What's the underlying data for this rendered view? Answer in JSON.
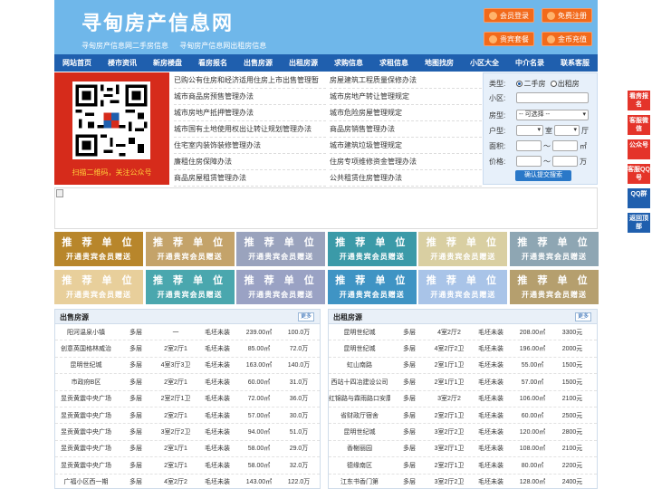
{
  "header": {
    "site_title": "寻甸房产信息网",
    "subtitle_1": "寻甸房产信息网二手房信息",
    "subtitle_2": "寻甸房产信息网出租房信息",
    "buttons": [
      "会员登录",
      "免费注册",
      "贵宾套餐",
      "金币充值"
    ],
    "bg_color": "#6fb7ea",
    "button_color": "#f26a1b"
  },
  "nav": {
    "items": [
      "网站首页",
      "楼市资讯",
      "新房楼盘",
      "看房报名",
      "出售房源",
      "出租房源",
      "求购信息",
      "求租信息",
      "地图找房",
      "小区大全",
      "中介名录",
      "联系客服"
    ],
    "bg_color": "#1f5fae"
  },
  "qr": {
    "caption": "扫描二维码，关注公众号"
  },
  "links": {
    "left": [
      "已购公有住房和经济适用住房上市出售管理暂",
      "城市商品房预售管理办法",
      "城市房地产抵押管理办法",
      "城市国有土地使用权出让转让规划管理办法",
      "住宅室内装饰装修管理办法",
      "廉租住房保障办法",
      "商品房屋租赁管理办法"
    ],
    "right": [
      "房屋建筑工程质量保修办法",
      "城市房地产转让管理规定",
      "城市危险房屋管理规定",
      "商品房销售管理办法",
      "城市建筑垃圾管理规定",
      "住房专项维修资金管理办法",
      "公共租赁住房管理办法"
    ]
  },
  "search": {
    "type_label": "类型:",
    "type_options": [
      "二手房",
      "出租房"
    ],
    "community_label": "小区:",
    "housetype_label": "房型:",
    "housetype_value": "-- 可选择 --",
    "layout_label": "户型:",
    "room_unit": "室",
    "hall_unit": "厅",
    "area_label": "面积:",
    "area_unit": "㎡",
    "range_sep": "〜",
    "price_label": "价格:",
    "price_unit": "万",
    "submit_label": "确认提交搜索"
  },
  "recommend": {
    "title": "推 荐 单 位",
    "subtitle": "开通贵宾会员赠送",
    "colors": [
      "#b8862b",
      "#c4a36a",
      "#9aa3bd",
      "#3b9aa8",
      "#d9cfa2",
      "#8ea6b3",
      "#e8cf9b",
      "#4aa7ae",
      "#9aa2c4",
      "#3f94c4",
      "#a9c4e8",
      "#b59f6e"
    ]
  },
  "sale": {
    "title": "出售房源",
    "more": "更多",
    "rows": [
      [
        "阳河温泉小镇",
        "多层",
        "一",
        "毛坯未装",
        "239.00㎡",
        "100.0万"
      ],
      [
        "创意英国格林威治",
        "多层",
        "2室2厅1",
        "毛坯未装",
        "85.00㎡",
        "72.0万"
      ],
      [
        "昆明世纪城",
        "多层",
        "4室3厅3卫",
        "毛坯未装",
        "163.00㎡",
        "140.0万"
      ],
      [
        "市政府B区",
        "多层",
        "2室2厅1",
        "毛坯未装",
        "60.00㎡",
        "31.0万"
      ],
      [
        "昱贡黄震中央广场",
        "多层",
        "2室2厅1卫",
        "毛坯未装",
        "72.00㎡",
        "36.0万"
      ],
      [
        "昱贡黄震中央广场",
        "多层",
        "2室2厅1",
        "毛坯未装",
        "57.00㎡",
        "30.0万"
      ],
      [
        "昱贡黄震中央广场",
        "多层",
        "3室2厅2卫",
        "毛坯未装",
        "94.00㎡",
        "51.0万"
      ],
      [
        "昱贡黄震中央广场",
        "多层",
        "2室1厅1",
        "毛坯未装",
        "58.00㎡",
        "29.0万"
      ],
      [
        "昱贡黄震中央广场",
        "多层",
        "2室1厅1",
        "毛坯未装",
        "58.00㎡",
        "32.0万"
      ],
      [
        "广福小区西一期",
        "多层",
        "4室2厅2",
        "毛坯未装",
        "143.00㎡",
        "122.0万"
      ]
    ]
  },
  "rent": {
    "title": "出租房源",
    "more": "更多",
    "rows": [
      [
        "昆明世纪城",
        "多层",
        "4室2厅2",
        "毛坯未装",
        "208.00㎡",
        "3300元"
      ],
      [
        "昆明世纪城",
        "多层",
        "4室2厅2卫",
        "毛坯未装",
        "196.00㎡",
        "2000元"
      ],
      [
        "虹山南路",
        "多层",
        "2室1厅1卫",
        "毛坯未装",
        "55.00㎡",
        "1500元"
      ],
      [
        "西站十四冶建设公司",
        "多层",
        "2室1厅1卫",
        "毛坯未装",
        "57.00㎡",
        "1500元"
      ],
      [
        "红锦路与霖雨路口安康",
        "多层",
        "3室2厅2",
        "毛坯未装",
        "106.00㎡",
        "2100元"
      ],
      [
        "省财政厅宿舍",
        "多层",
        "2室2厅1卫",
        "毛坯未装",
        "60.00㎡",
        "2500元"
      ],
      [
        "昆明世纪城",
        "多层",
        "3室2厅2卫",
        "毛坯未装",
        "120.00㎡",
        "2800元"
      ],
      [
        "香榭丽园",
        "多层",
        "3室2厅1卫",
        "毛坯未装",
        "108.00㎡",
        "2100元"
      ],
      [
        "德缘南区",
        "多层",
        "2室2厅1卫",
        "毛坯未装",
        "80.00㎡",
        "2200元"
      ],
      [
        "江东书香门第",
        "多层",
        "3室2厅2卫",
        "毛坯未装",
        "128.00㎡",
        "2400元"
      ]
    ]
  },
  "float_bar": {
    "items": [
      "看房报名",
      "客服微信",
      "公众号",
      "客服QQ号",
      "QQ群",
      "返回顶部"
    ]
  }
}
